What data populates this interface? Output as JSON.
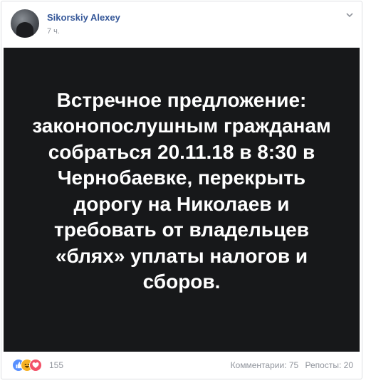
{
  "post": {
    "author": "Sikorskiy Alexey",
    "time": "7 ч.",
    "banner_text": "Встречное предложение: законопослушным гражданам собраться 20.11.18 в 8:30 в Чернобаевке, перекрыть дорогу на Николаев и требовать от владельцев «блях» уплаты налогов и сборов."
  },
  "footer": {
    "reaction_icons": [
      "like-icon",
      "haha-icon",
      "love-icon"
    ],
    "reaction_count": "155",
    "comments": "Комментарии: 75",
    "shares": "Репосты: 20"
  },
  "colors": {
    "author_link": "#365899",
    "banner_bg": "#17181a",
    "like": "#5890ff",
    "haha": "#f7b125",
    "love": "#f25268"
  }
}
